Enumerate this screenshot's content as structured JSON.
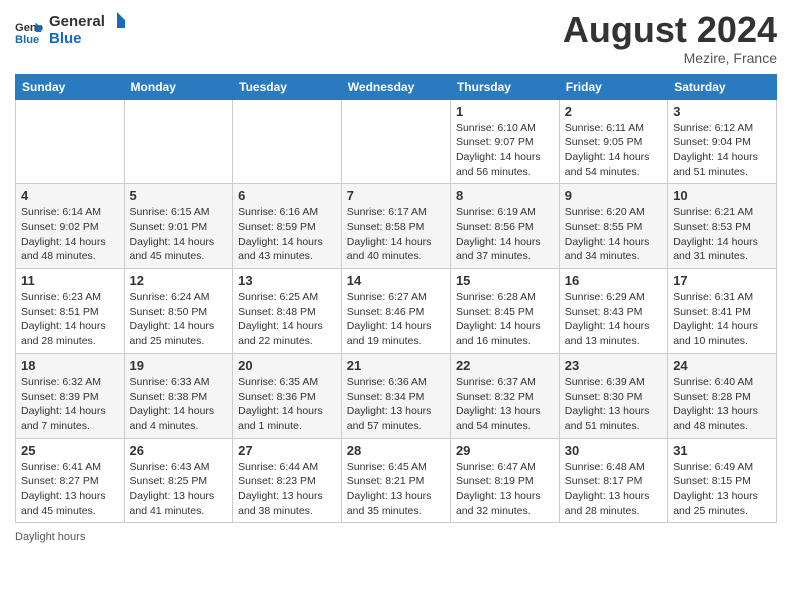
{
  "header": {
    "logo_line1": "General",
    "logo_line2": "Blue",
    "month_title": "August 2024",
    "location": "Mezire, France"
  },
  "days_of_week": [
    "Sunday",
    "Monday",
    "Tuesday",
    "Wednesday",
    "Thursday",
    "Friday",
    "Saturday"
  ],
  "weeks": [
    [
      {
        "day": "",
        "info": ""
      },
      {
        "day": "",
        "info": ""
      },
      {
        "day": "",
        "info": ""
      },
      {
        "day": "",
        "info": ""
      },
      {
        "day": "1",
        "info": "Sunrise: 6:10 AM\nSunset: 9:07 PM\nDaylight: 14 hours\nand 56 minutes."
      },
      {
        "day": "2",
        "info": "Sunrise: 6:11 AM\nSunset: 9:05 PM\nDaylight: 14 hours\nand 54 minutes."
      },
      {
        "day": "3",
        "info": "Sunrise: 6:12 AM\nSunset: 9:04 PM\nDaylight: 14 hours\nand 51 minutes."
      }
    ],
    [
      {
        "day": "4",
        "info": "Sunrise: 6:14 AM\nSunset: 9:02 PM\nDaylight: 14 hours\nand 48 minutes."
      },
      {
        "day": "5",
        "info": "Sunrise: 6:15 AM\nSunset: 9:01 PM\nDaylight: 14 hours\nand 45 minutes."
      },
      {
        "day": "6",
        "info": "Sunrise: 6:16 AM\nSunset: 8:59 PM\nDaylight: 14 hours\nand 43 minutes."
      },
      {
        "day": "7",
        "info": "Sunrise: 6:17 AM\nSunset: 8:58 PM\nDaylight: 14 hours\nand 40 minutes."
      },
      {
        "day": "8",
        "info": "Sunrise: 6:19 AM\nSunset: 8:56 PM\nDaylight: 14 hours\nand 37 minutes."
      },
      {
        "day": "9",
        "info": "Sunrise: 6:20 AM\nSunset: 8:55 PM\nDaylight: 14 hours\nand 34 minutes."
      },
      {
        "day": "10",
        "info": "Sunrise: 6:21 AM\nSunset: 8:53 PM\nDaylight: 14 hours\nand 31 minutes."
      }
    ],
    [
      {
        "day": "11",
        "info": "Sunrise: 6:23 AM\nSunset: 8:51 PM\nDaylight: 14 hours\nand 28 minutes."
      },
      {
        "day": "12",
        "info": "Sunrise: 6:24 AM\nSunset: 8:50 PM\nDaylight: 14 hours\nand 25 minutes."
      },
      {
        "day": "13",
        "info": "Sunrise: 6:25 AM\nSunset: 8:48 PM\nDaylight: 14 hours\nand 22 minutes."
      },
      {
        "day": "14",
        "info": "Sunrise: 6:27 AM\nSunset: 8:46 PM\nDaylight: 14 hours\nand 19 minutes."
      },
      {
        "day": "15",
        "info": "Sunrise: 6:28 AM\nSunset: 8:45 PM\nDaylight: 14 hours\nand 16 minutes."
      },
      {
        "day": "16",
        "info": "Sunrise: 6:29 AM\nSunset: 8:43 PM\nDaylight: 14 hours\nand 13 minutes."
      },
      {
        "day": "17",
        "info": "Sunrise: 6:31 AM\nSunset: 8:41 PM\nDaylight: 14 hours\nand 10 minutes."
      }
    ],
    [
      {
        "day": "18",
        "info": "Sunrise: 6:32 AM\nSunset: 8:39 PM\nDaylight: 14 hours\nand 7 minutes."
      },
      {
        "day": "19",
        "info": "Sunrise: 6:33 AM\nSunset: 8:38 PM\nDaylight: 14 hours\nand 4 minutes."
      },
      {
        "day": "20",
        "info": "Sunrise: 6:35 AM\nSunset: 8:36 PM\nDaylight: 14 hours\nand 1 minute."
      },
      {
        "day": "21",
        "info": "Sunrise: 6:36 AM\nSunset: 8:34 PM\nDaylight: 13 hours\nand 57 minutes."
      },
      {
        "day": "22",
        "info": "Sunrise: 6:37 AM\nSunset: 8:32 PM\nDaylight: 13 hours\nand 54 minutes."
      },
      {
        "day": "23",
        "info": "Sunrise: 6:39 AM\nSunset: 8:30 PM\nDaylight: 13 hours\nand 51 minutes."
      },
      {
        "day": "24",
        "info": "Sunrise: 6:40 AM\nSunset: 8:28 PM\nDaylight: 13 hours\nand 48 minutes."
      }
    ],
    [
      {
        "day": "25",
        "info": "Sunrise: 6:41 AM\nSunset: 8:27 PM\nDaylight: 13 hours\nand 45 minutes."
      },
      {
        "day": "26",
        "info": "Sunrise: 6:43 AM\nSunset: 8:25 PM\nDaylight: 13 hours\nand 41 minutes."
      },
      {
        "day": "27",
        "info": "Sunrise: 6:44 AM\nSunset: 8:23 PM\nDaylight: 13 hours\nand 38 minutes."
      },
      {
        "day": "28",
        "info": "Sunrise: 6:45 AM\nSunset: 8:21 PM\nDaylight: 13 hours\nand 35 minutes."
      },
      {
        "day": "29",
        "info": "Sunrise: 6:47 AM\nSunset: 8:19 PM\nDaylight: 13 hours\nand 32 minutes."
      },
      {
        "day": "30",
        "info": "Sunrise: 6:48 AM\nSunset: 8:17 PM\nDaylight: 13 hours\nand 28 minutes."
      },
      {
        "day": "31",
        "info": "Sunrise: 6:49 AM\nSunset: 8:15 PM\nDaylight: 13 hours\nand 25 minutes."
      }
    ]
  ],
  "footer": {
    "daylight_label": "Daylight hours"
  }
}
